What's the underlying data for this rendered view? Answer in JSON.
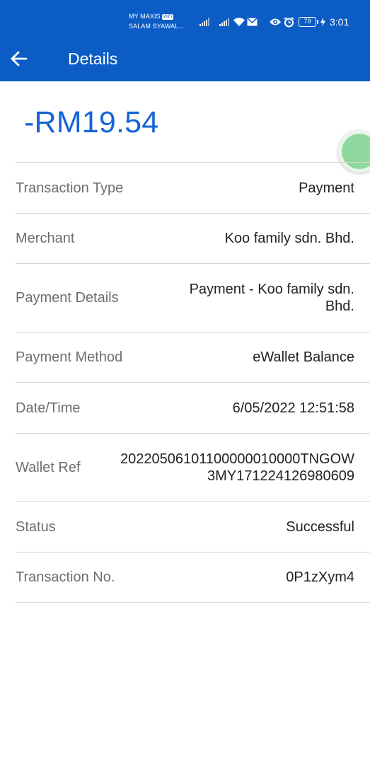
{
  "status_bar": {
    "carrier_line1": "MY MAXIS",
    "wifi_tag": "WiFi",
    "carrier_line2": "SALAM SYAWAL...",
    "battery": "79",
    "time": "3:01"
  },
  "header": {
    "title": "Details"
  },
  "amount": "-RM19.54",
  "details": [
    {
      "label": "Transaction Type",
      "value": "Payment"
    },
    {
      "label": "Merchant",
      "value": "Koo family sdn. Bhd."
    },
    {
      "label": "Payment Details",
      "value_lines": [
        "Payment - Koo family sdn.",
        "Bhd."
      ]
    },
    {
      "label": "Payment Method",
      "value": "eWallet Balance"
    },
    {
      "label": "Date/Time",
      "value": "6/05/2022 12:51:58"
    },
    {
      "label": "Wallet Ref",
      "value_lines": [
        "20220506101100000010000TNGOW",
        "3MY171224126980609"
      ]
    },
    {
      "label": "Status",
      "value": "Successful"
    },
    {
      "label": "Transaction No.",
      "value": "0P1zXym4"
    }
  ],
  "colors": {
    "header_bg": "#0b5cc5",
    "amount": "#1565d8",
    "whatsapp": "#8fd99f"
  },
  "icons": [
    "signal-icon",
    "wifi-icon",
    "mail-icon",
    "eye-icon",
    "alarm-icon",
    "charging-icon",
    "back-arrow-icon",
    "whatsapp-icon"
  ]
}
